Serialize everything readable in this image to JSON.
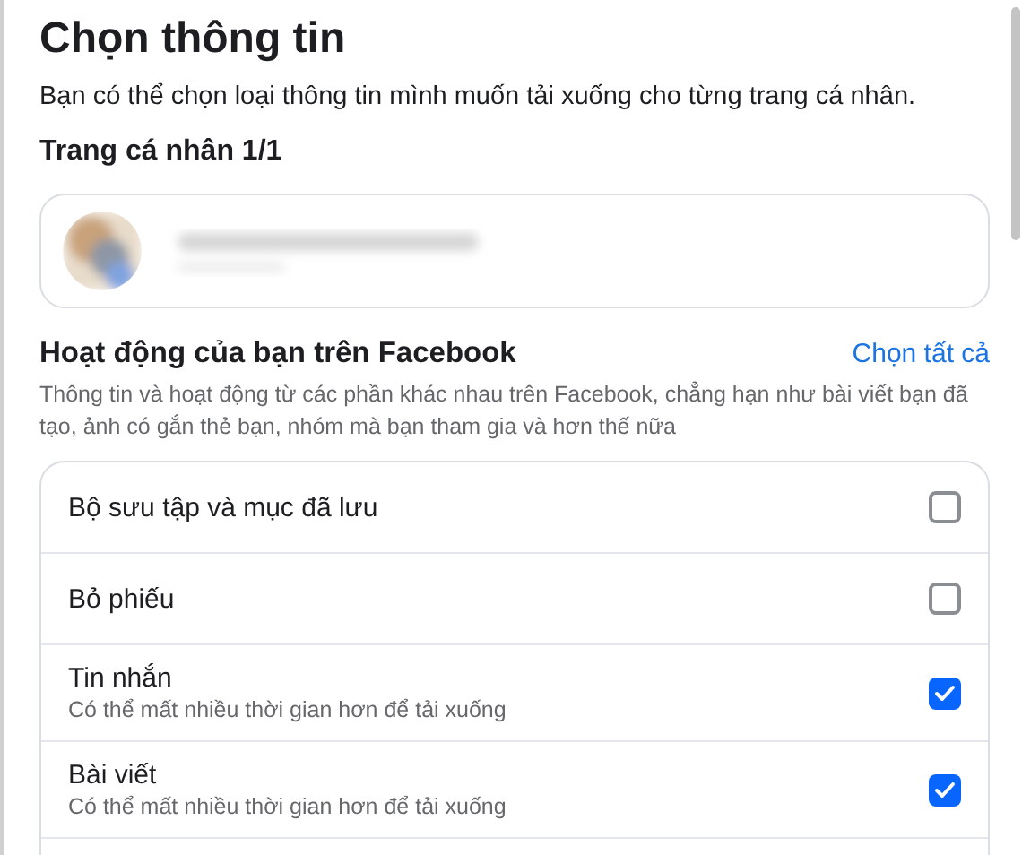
{
  "title": "Chọn thông tin",
  "subtitle": "Bạn có thể chọn loại thông tin mình muốn tải xuống cho từng trang cá nhân.",
  "profile_heading": "Trang cá nhân 1/1",
  "section": {
    "title": "Hoạt động của bạn trên Facebook",
    "select_all": "Chọn tất cả",
    "description": "Thông tin và hoạt động từ các phần khác nhau trên Facebook, chẳng hạn như bài viết bạn đã tạo, ảnh có gắn thẻ bạn, nhóm mà bạn tham gia và hơn thế nữa"
  },
  "items": [
    {
      "label": "Bộ sưu tập và mục đã lưu",
      "checked": false
    },
    {
      "label": "Bỏ phiếu",
      "checked": false
    },
    {
      "label": "Tin nhắn",
      "note": "Có thể mất nhiều thời gian hơn để tải xuống",
      "checked": true
    },
    {
      "label": "Bài viết",
      "note": "Có thể mất nhiều thời gian hơn để tải xuống",
      "checked": true
    }
  ]
}
